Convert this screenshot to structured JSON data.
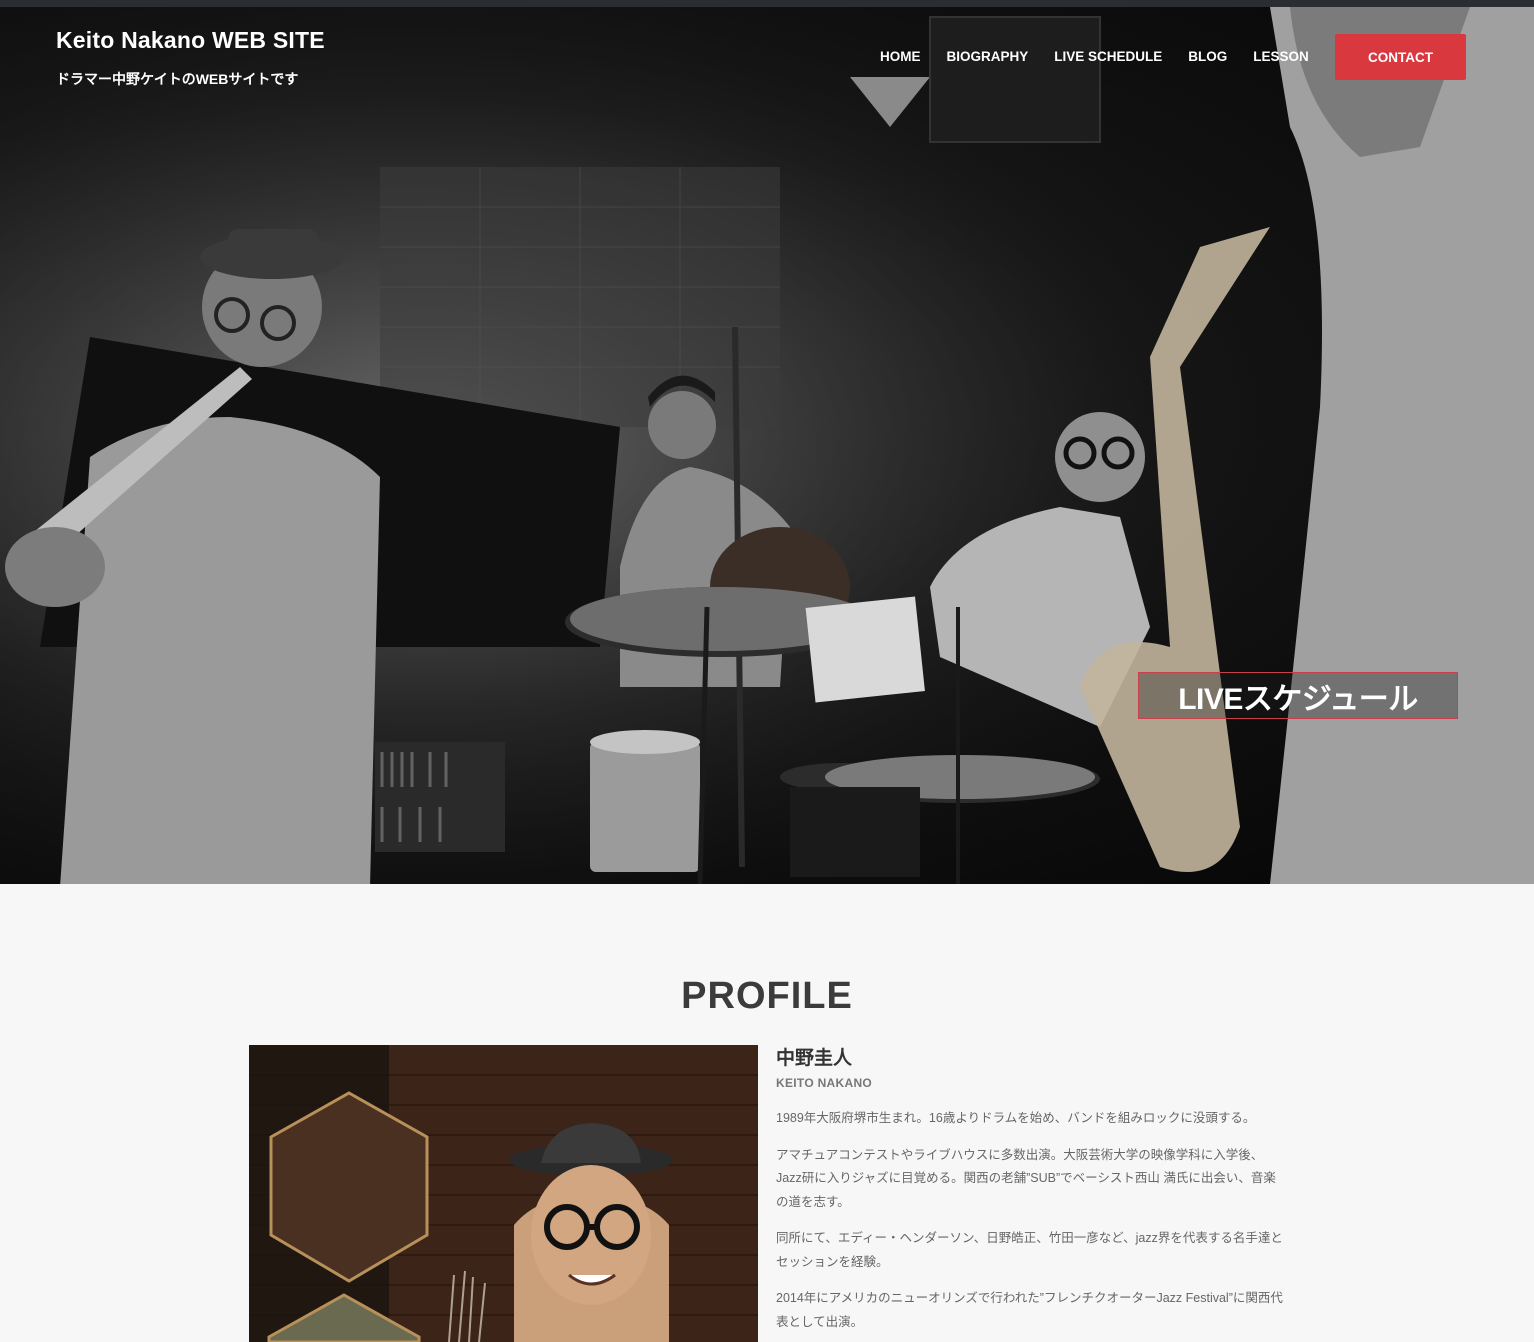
{
  "site": {
    "title": "Keito Nakano WEB SITE",
    "tagline": "ドラマー中野ケイトのWEBサイトです"
  },
  "nav": {
    "items": [
      {
        "label": "HOME"
      },
      {
        "label": "BIOGRAPHY"
      },
      {
        "label": "LIVE SCHEDULE"
      },
      {
        "label": "BLOG"
      },
      {
        "label": "LESSON"
      }
    ],
    "contact_label": "CONTACT"
  },
  "hero": {
    "live_button_label": "LIVEスケジュール"
  },
  "profile": {
    "heading": "PROFILE",
    "name_ja": "中野圭人",
    "name_en": "KEITO NAKANO",
    "paragraphs": [
      "1989年大阪府堺市生まれ。16歳よりドラムを始め、バンドを組みロックに没頭する。",
      "アマチュアコンテストやライブハウスに多数出演。大阪芸術大学の映像学科に入学後、Jazz研に入りジャズに目覚める。関西の老舗”SUB”でベーシスト西山 満氏に出会い、音楽の道を志す。",
      "同所にて、エディー・ヘンダーソン、日野皓正、竹田一彦など、jazz界を代表する名手達とセッションを経験。",
      "2014年にアメリカのニューオリンズで行われた”フレンチクオーターJazz Festival”に関西代表として出演。"
    ]
  },
  "colors": {
    "accent": "#d9393e",
    "background": "#f7f7f7",
    "heading": "#3b3b3b"
  }
}
